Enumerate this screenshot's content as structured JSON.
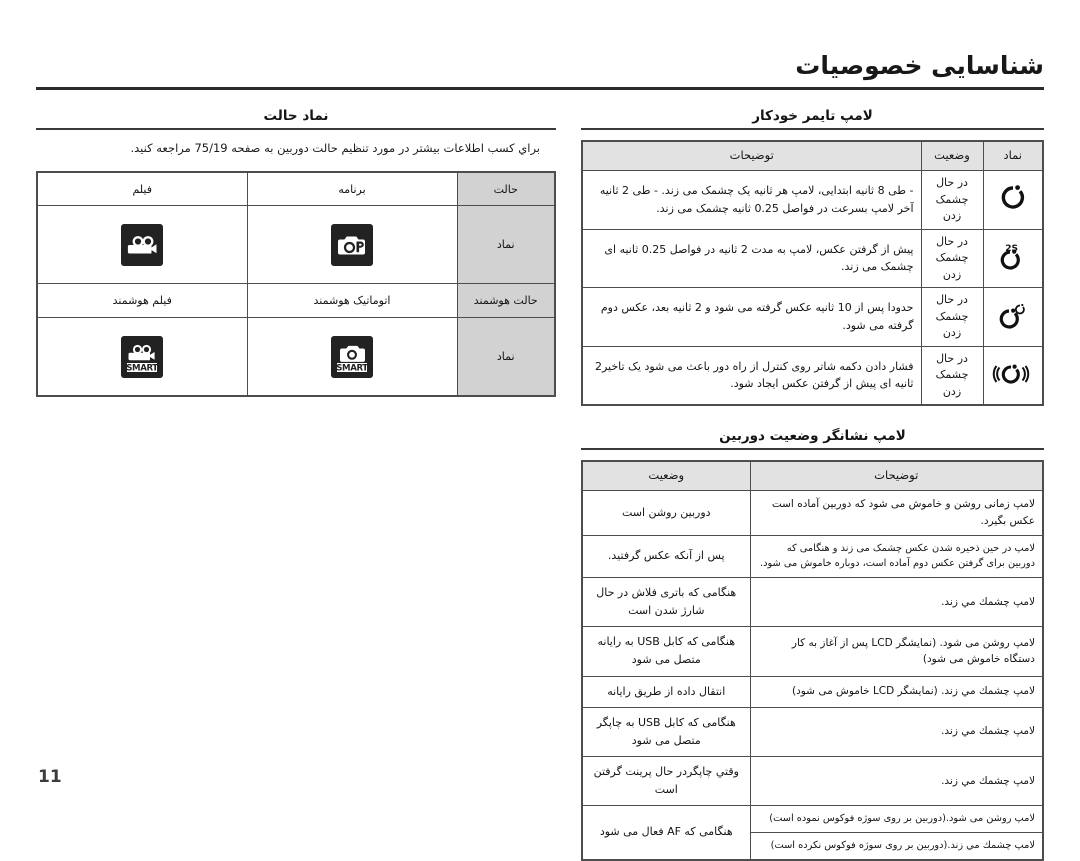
{
  "page": {
    "title": "شناسایی خصوصیات",
    "number": "11"
  },
  "right_column": {
    "timer_section": {
      "title": "لامپ تایمر خودکار",
      "headers": {
        "symbol": "نماد",
        "state": "وضعیت",
        "description": "توضیحات"
      },
      "rows": [
        {
          "icon": "self-timer-icon",
          "state": "در حال چشمک زدن",
          "description": "- طی 8 ثانیه ابتدایی، لامپ هر ثانیه یک چشمک می زند.\n- طی 2 ثانیه آخر لامپ بسرعت در فواصل 0.25 ثانیه چشمک می زند."
        },
        {
          "icon": "self-timer-2s-icon",
          "state": "در حال چشمک زدن",
          "description": "پیش از گرفتن عکس، لامپ به مدت 2 ثانیه در فواصل 0.25 ثانیه ای چشمک می زند."
        },
        {
          "icon": "double-self-timer-icon",
          "state": "در حال چشمک زدن",
          "description": "حدودا پس از 10 ثانیه عکس گرفته می شود و 2 ثانیه بعد، عکس دوم گرفته می شود."
        },
        {
          "icon": "remote-timer-icon",
          "state": "در حال چشمک زدن",
          "description": "فشار دادن دکمه شاتر روی کنترل از راه دور باعث می شود یک تاخیر2 ثانیه ای پیش از گرفتن عکس ایجاد شود."
        }
      ]
    },
    "lamp_section": {
      "title": "لامپ نشانگر وضعیت دوربین",
      "headers": {
        "state": "وضعیت",
        "description": "توضیحات"
      },
      "rows": [
        {
          "state": "دوربین روشن است",
          "descriptions": [
            "لامپ زمانی روشن و خاموش می شود که دوربین آماده است عکس بگیرد."
          ]
        },
        {
          "state": "پس از آنکه عکس گرفتید.",
          "descriptions": [
            "لامپ در حین ذخیره شدن عکس چشمک می زند و هنگامی که دوربین برای گرفتن عکس دوم آماده است، دوباره خاموش می شود."
          ]
        },
        {
          "state": "هنگامی که باتری فلاش در حال شارژ شدن است",
          "descriptions": [
            "لامپ چشمك مي زند."
          ]
        },
        {
          "state": "هنگامی که کابل USB به رایانه متصل می شود",
          "descriptions": [
            "لامپ روشن می شود. (نمایشگر LCD پس از آغاز به کار دستگاه خاموش می شود)"
          ]
        },
        {
          "state": "انتقال داده از طریق رایانه",
          "descriptions": [
            "لامپ چشمك مي زند. (نمایشگر LCD خاموش می شود)"
          ]
        },
        {
          "state": "هنگامی که کابل USB به چاپگر متصل می شود",
          "descriptions": [
            "لامپ چشمك مي زند."
          ]
        },
        {
          "state": "وقتي چاپگردر حال پرینت گرفتن است",
          "descriptions": [
            "لامپ چشمك مي زند."
          ]
        },
        {
          "state": "هنگامی که AF فعال می شود",
          "descriptions": [
            "لامپ روشن می شود.(دوربین بر روی سوژه فوکوس نموده است)",
            "لامپ چشمك مي زند.(دوربین بر روی سوژه فوکوس نکرده است)"
          ]
        }
      ]
    }
  },
  "left_column": {
    "mode_section": {
      "title": "نماد حالت",
      "note": "براي كسب اطلاعات بيشتر در مورد تنظيم حالت دوربين به صفحه 75/19 مراجعه كنيد.",
      "table": {
        "header_row": {
          "label": "حالت",
          "cells": [
            "برنامه",
            "فیلم"
          ]
        },
        "icon_row_1": {
          "label": "نماد",
          "icons": [
            "program-camera-icon",
            "movie-camera-icon"
          ]
        },
        "smart_row": {
          "label": "حالت هوشمند",
          "cells": [
            "اتوماتیک هوشمند",
            "فیلم هوشمند"
          ]
        },
        "icon_row_2": {
          "label": "نماد",
          "icons": [
            "smart-auto-camera-icon",
            "smart-movie-camera-icon"
          ]
        }
      }
    }
  },
  "colors": {
    "header_bg": "#e2e2e2",
    "label_bg": "#d2d2d2",
    "border": "#4d4d4d",
    "icon_tile": "#222222",
    "text": "#141414"
  }
}
